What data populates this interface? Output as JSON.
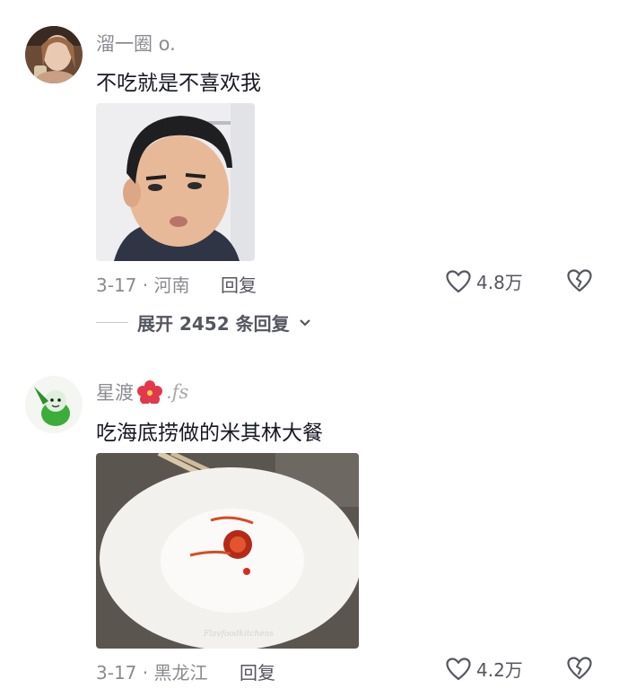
{
  "comments": [
    {
      "username": "溜一圈 o.",
      "text": "不吃就是不喜欢我",
      "date_location": "3-17 · 河南",
      "reply_label": "回复",
      "likes": "4.8万",
      "expand": {
        "label": "展开 2452 条回复"
      }
    },
    {
      "username": "星渡",
      "username_suffix": ".fs",
      "text": "吃海底捞做的米其林大餐",
      "date_location": "3-17 · 黑龙江",
      "reply_label": "回复",
      "likes": "4.2万"
    }
  ],
  "colors": {
    "secondary_text": "#8a8b91",
    "primary_text": "#161823",
    "action_text": "#545660"
  }
}
